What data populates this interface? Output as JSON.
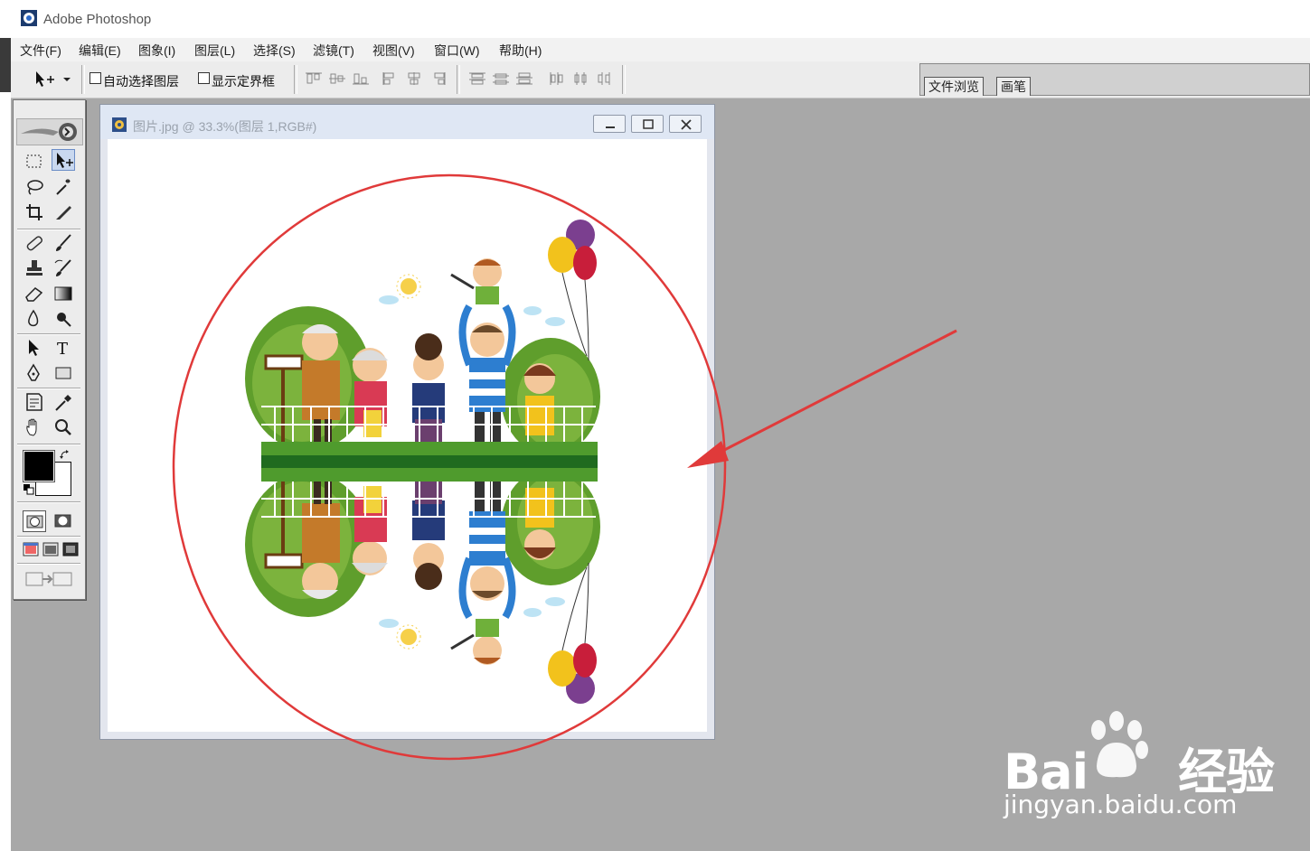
{
  "app": {
    "title": "Adobe Photoshop"
  },
  "menu": [
    "文件(F)",
    "编辑(E)",
    "图象(I)",
    "图层(L)",
    "选择(S)",
    "滤镜(T)",
    "视图(V)",
    "窗口(W)",
    "帮助(H)"
  ],
  "options": {
    "auto_select_label": "自动选择图层",
    "auto_select_checked": false,
    "show_bounds_label": "显示定界框",
    "show_bounds_checked": false
  },
  "palette_tabs": [
    "文件浏览",
    "画笔"
  ],
  "document": {
    "title": "图片.jpg @ 33.3%(图层 1,RGB#)"
  },
  "colors": {
    "foreground": "#000000",
    "background": "#ffffff",
    "annotation": "#e03a3a"
  },
  "watermark": {
    "brand": "Bai",
    "brand_suffix": "经验",
    "url": "jingyan.baidu.com"
  }
}
